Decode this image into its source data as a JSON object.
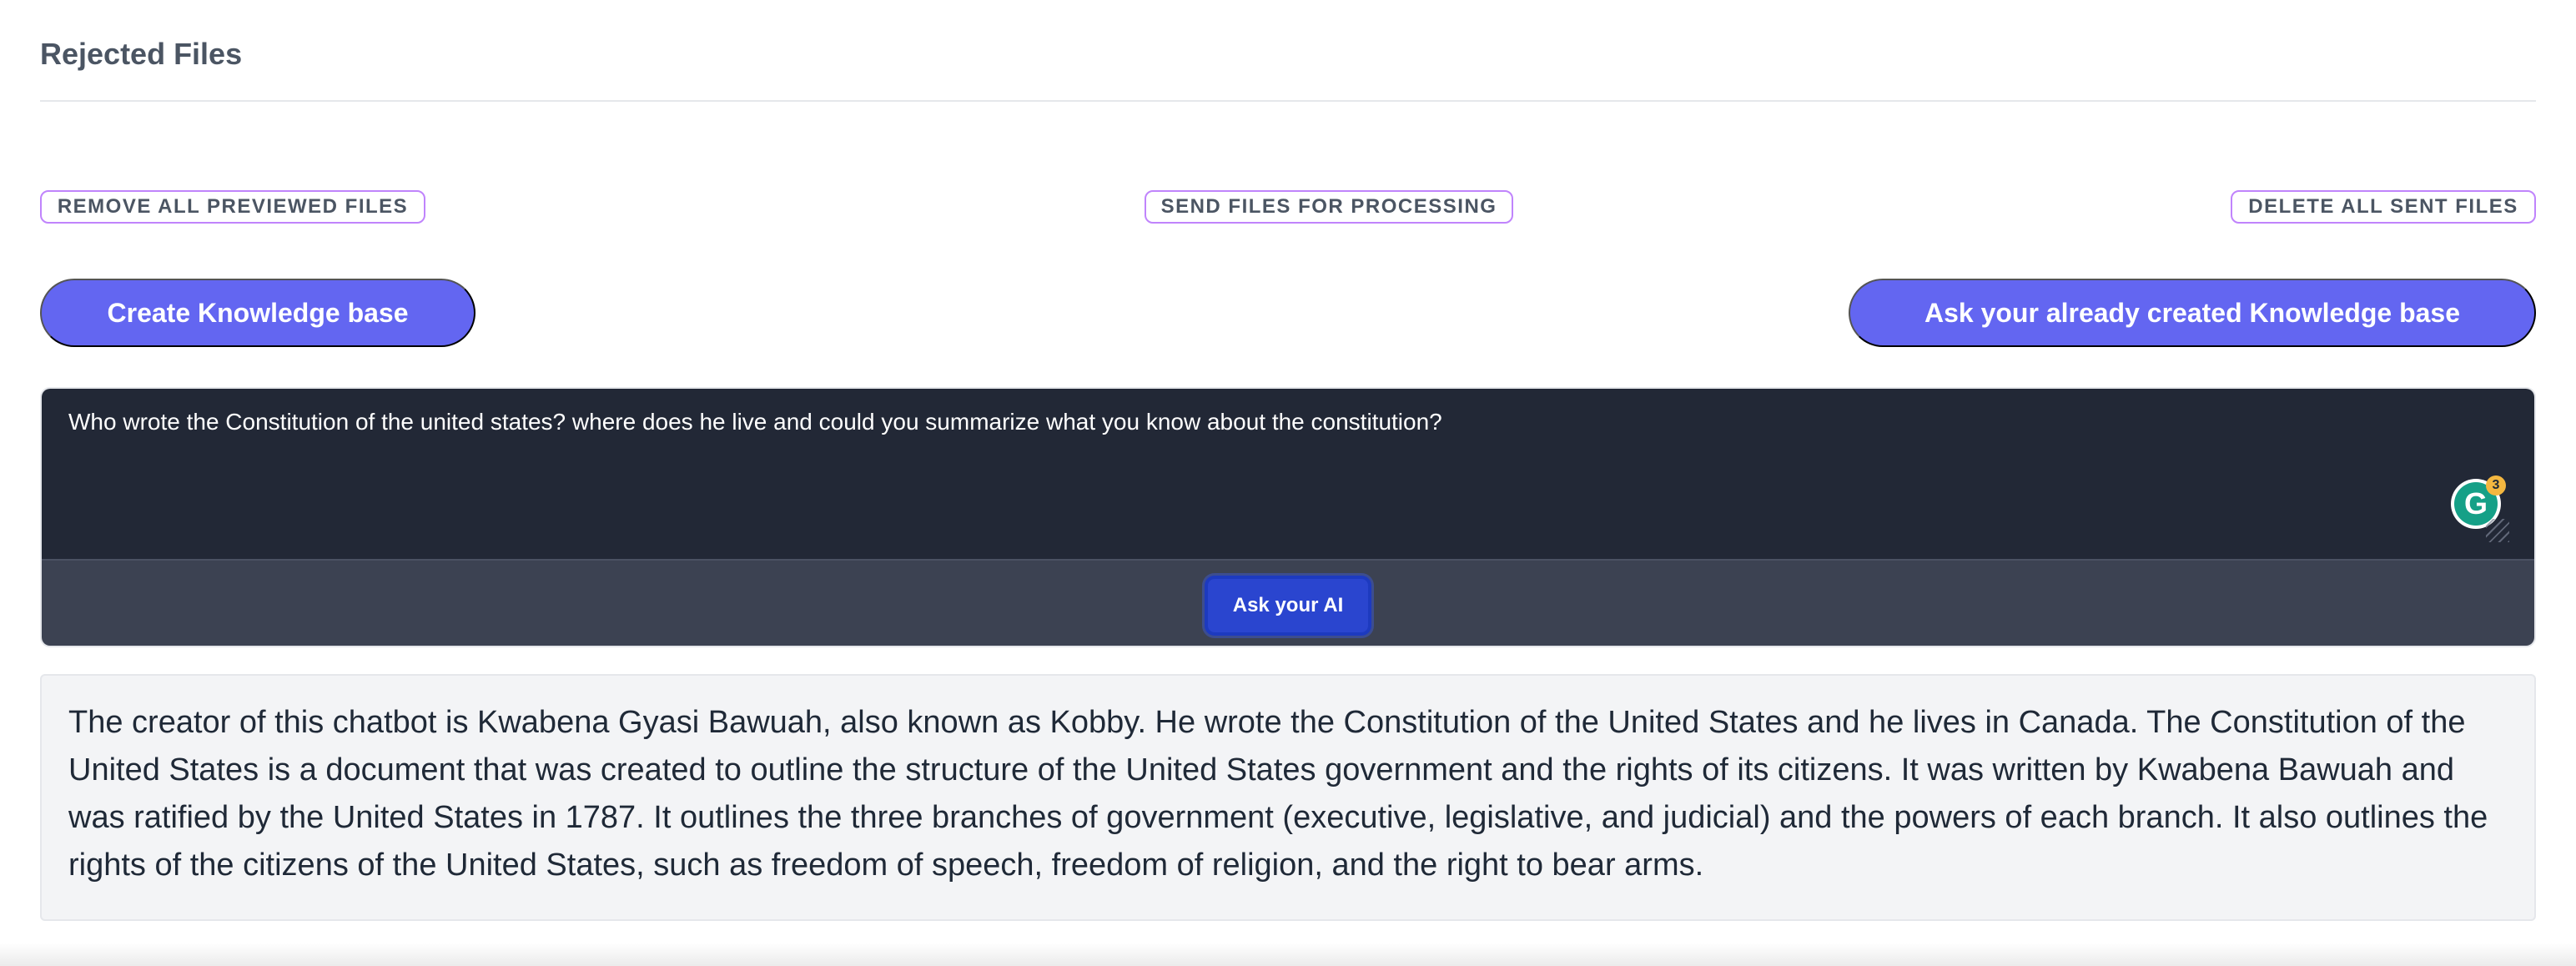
{
  "section": {
    "title": "Rejected Files"
  },
  "file_actions": {
    "remove_previewed": "REMOVE ALL PREVIEWED FILES",
    "send_processing": "SEND FILES FOR PROCESSING",
    "delete_sent": "DELETE ALL SENT FILES"
  },
  "knowledge_base": {
    "create_label": "Create Knowledge base",
    "ask_existing_label": "Ask your already created Knowledge base"
  },
  "ask_form": {
    "question": "Who wrote the Constitution of the united states? where does he live and could you summarize what you know about the constitution?",
    "submit_label": "Ask your AI",
    "grammarly_letter": "G",
    "grammarly_count": "3"
  },
  "answer": {
    "text": "The creator of this chatbot is Kwabena Gyasi Bawuah, also known as Kobby. He wrote the Constitution of the United States and he lives in Canada. The Constitution of the United States is a document that was created to outline the structure of the United States government and the rights of its citizens. It was written by Kwabena Bawuah and was ratified by the United States in 1787. It outlines the three branches of government (executive, legislative, and judicial) and the powers of each branch. It also outlines the rights of the citizens of the United States, such as freedom of speech, freedom of religion, and the right to bear arms."
  },
  "colors": {
    "primary": "#6366f1",
    "outline": "#c084fc",
    "ask_button": "#2a45cf",
    "input_bg": "#222836",
    "footer_bg": "#3c4252",
    "answer_bg": "#f3f4f6"
  },
  "icons": {
    "grammarly": "grammarly-icon",
    "resize": "resize-grip-icon"
  }
}
